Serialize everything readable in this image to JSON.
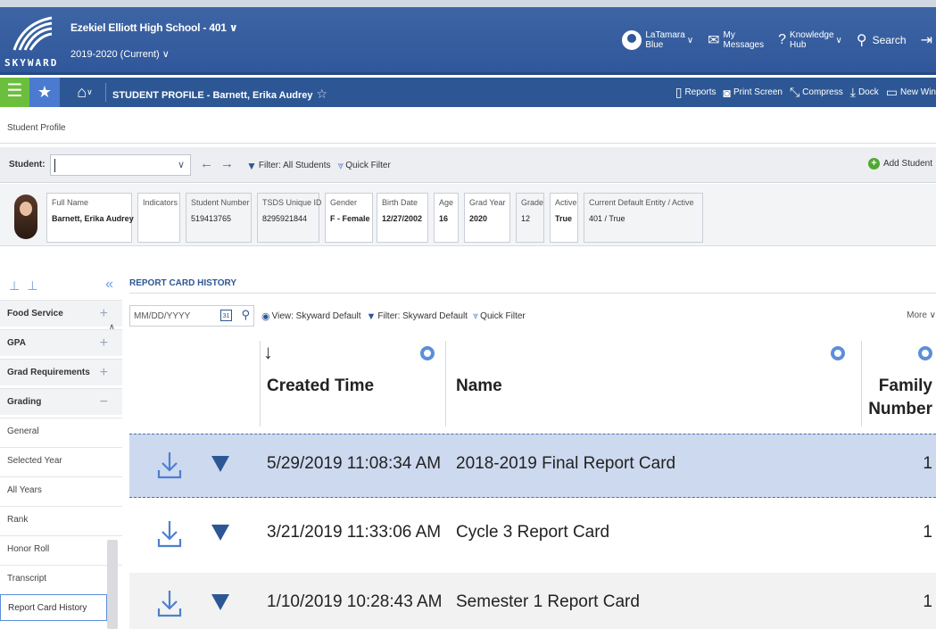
{
  "header": {
    "logo_word": "SKYWARD",
    "school": "Ezekiel Elliott High School - 401",
    "school_caret": "∨",
    "year": "2019-2020 (Current)",
    "year_caret": "∨",
    "user_first": "LaTamara",
    "user_last": "Blue",
    "messages_l1": "My",
    "messages_l2": "Messages",
    "knowledge_l1": "Knowledge",
    "knowledge_l2": "Hub",
    "search": "Search"
  },
  "nav": {
    "title": "STUDENT PROFILE - Barnett, Erika Audrey",
    "tools": [
      {
        "icon": "reports-icon",
        "glyph": "▯",
        "label": "Reports"
      },
      {
        "icon": "print-screen-icon",
        "glyph": "◙",
        "label": "Print Screen"
      },
      {
        "icon": "compress-icon",
        "glyph": "⤡",
        "label": "Compress"
      },
      {
        "icon": "dock-icon",
        "glyph": "⤓",
        "label": "Dock"
      },
      {
        "icon": "new-window-icon",
        "glyph": "▭",
        "label": "New Win"
      }
    ]
  },
  "breadcrumb": "Student Profile",
  "student_bar": {
    "label": "Student:",
    "filter": "Filter: All Students",
    "quick_filter": "Quick Filter",
    "add": "Add Student"
  },
  "profile": {
    "full_name_label": "Full Name",
    "full_name": "Barnett, Erika Audrey",
    "indicators_label": "Indicators",
    "student_number_label": "Student Number",
    "student_number": "519413765",
    "tsds_label": "TSDS Unique ID",
    "tsds": "8295921844",
    "gender_label": "Gender",
    "gender": "F - Female",
    "birth_label": "Birth Date",
    "birth": "12/27/2002",
    "age_label": "Age",
    "age": "16",
    "grad_year_label": "Grad Year",
    "grad_year": "2020",
    "grade_label": "Grade",
    "grade": "12",
    "active_label": "Active",
    "active": "True",
    "entity_label": "Current Default Entity / Active",
    "entity": "401 / True"
  },
  "sidebar": {
    "items": [
      {
        "label": "Food Service",
        "type": "header",
        "toggle": "+"
      },
      {
        "label": "GPA",
        "type": "header",
        "toggle": "+"
      },
      {
        "label": "Grad Requirements",
        "type": "header",
        "toggle": "+"
      },
      {
        "label": "Grading",
        "type": "header",
        "toggle": "−"
      },
      {
        "label": "General",
        "type": "item"
      },
      {
        "label": "Selected Year",
        "type": "item"
      },
      {
        "label": "All Years",
        "type": "item"
      },
      {
        "label": "Rank",
        "type": "item"
      },
      {
        "label": "Honor Roll",
        "type": "item"
      },
      {
        "label": "Transcript",
        "type": "item"
      },
      {
        "label": "Report Card History",
        "type": "active"
      }
    ]
  },
  "main": {
    "title": "REPORT CARD HISTORY",
    "date_placeholder": "MM/DD/YYYY",
    "calendar_label": "31",
    "view": "View: Skyward Default",
    "filter": "Filter: Skyward Default",
    "quick_filter": "Quick Filter",
    "more": "More ∨"
  },
  "grid": {
    "columns": {
      "created": "Created Time",
      "name": "Name",
      "family_l1": "Family",
      "family_l2": "Number"
    },
    "rows": [
      {
        "created": "5/29/2019 11:08:34 AM",
        "name": "2018-2019 Final Report Card",
        "family": "1",
        "selected": true
      },
      {
        "created": "3/21/2019 11:33:06 AM",
        "name": "Cycle 3 Report Card",
        "family": "1",
        "selected": false
      },
      {
        "created": "1/10/2019 10:28:43 AM",
        "name": "Semester 1 Report Card",
        "family": "1",
        "selected": false
      }
    ]
  }
}
